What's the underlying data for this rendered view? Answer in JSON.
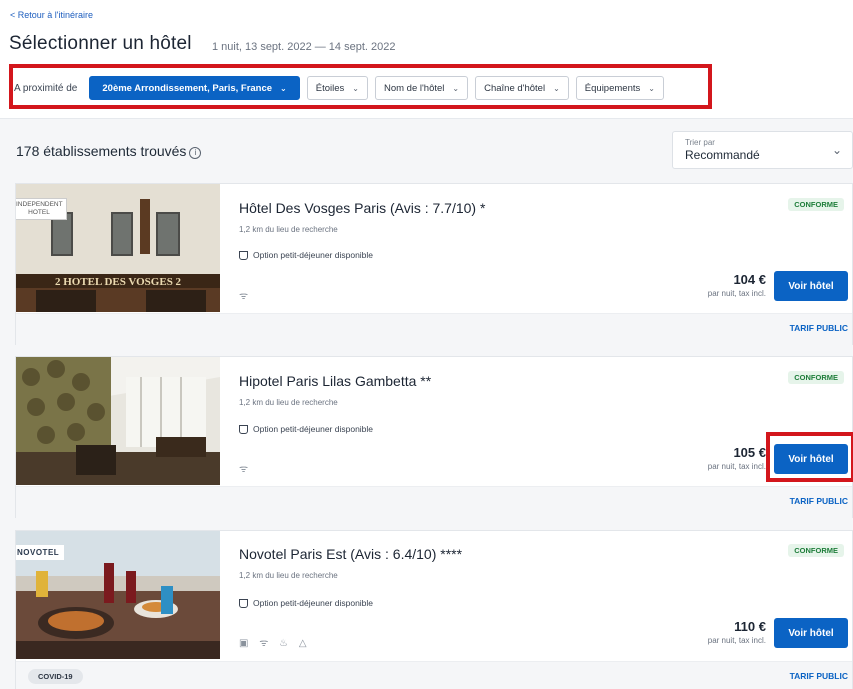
{
  "header": {
    "back_link": "< Retour à l'itinéraire",
    "title": "Sélectionner un hôtel",
    "subtitle": "1 nuit, 13 sept. 2022 — 14 sept. 2022"
  },
  "filters": {
    "near_label": "A proximité de",
    "location": "20ème Arrondissement, Paris, France",
    "stars": "Étoiles",
    "hotel_name": "Nom de l'hôtel",
    "hotel_chain": "Chaîne d'hôtel",
    "amenities": "Équipements"
  },
  "results": {
    "count_text": "178 établissements trouvés",
    "sort_label": "Trier par",
    "sort_value": "Recommandé"
  },
  "hotels": [
    {
      "name": "Hôtel Des Vosges Paris (Avis : 7.7/10) *",
      "distance": "1,2 km du lieu de recherche",
      "breakfast": "Option petit-déjeuner disponible",
      "amenities": "ᯤ",
      "badge": "CONFORME",
      "price": "104 €",
      "price_note": "par nuit, tax incl.",
      "button": "Voir hôtel",
      "footer_label": "TARIF PUBLIC",
      "photo_tag": "INDEPENDENT HOTEL",
      "photo_sign": "2 HOTEL DES VOSGES 2"
    },
    {
      "name": "Hipotel Paris Lilas Gambetta **",
      "distance": "1,2 km du lieu de recherche",
      "breakfast": "Option petit-déjeuner disponible",
      "amenities": "ᯤ",
      "badge": "CONFORME",
      "price": "105 €",
      "price_note": "par nuit, tax incl.",
      "button": "Voir hôtel",
      "footer_label": "TARIF PUBLIC"
    },
    {
      "name": "Novotel Paris Est (Avis : 6.4/10) ****",
      "distance": "1,2 km du lieu de recherche",
      "breakfast": "Option petit-déjeuner disponible",
      "amenities": "▣ ᯤ ♨ △",
      "badge": "CONFORME",
      "price": "110 €",
      "price_note": "par nuit, tax incl.",
      "button": "Voir hôtel",
      "footer_label": "TARIF PUBLIC",
      "covid_label": "COVID-19",
      "photo_tag": "NOVOTEL"
    }
  ]
}
